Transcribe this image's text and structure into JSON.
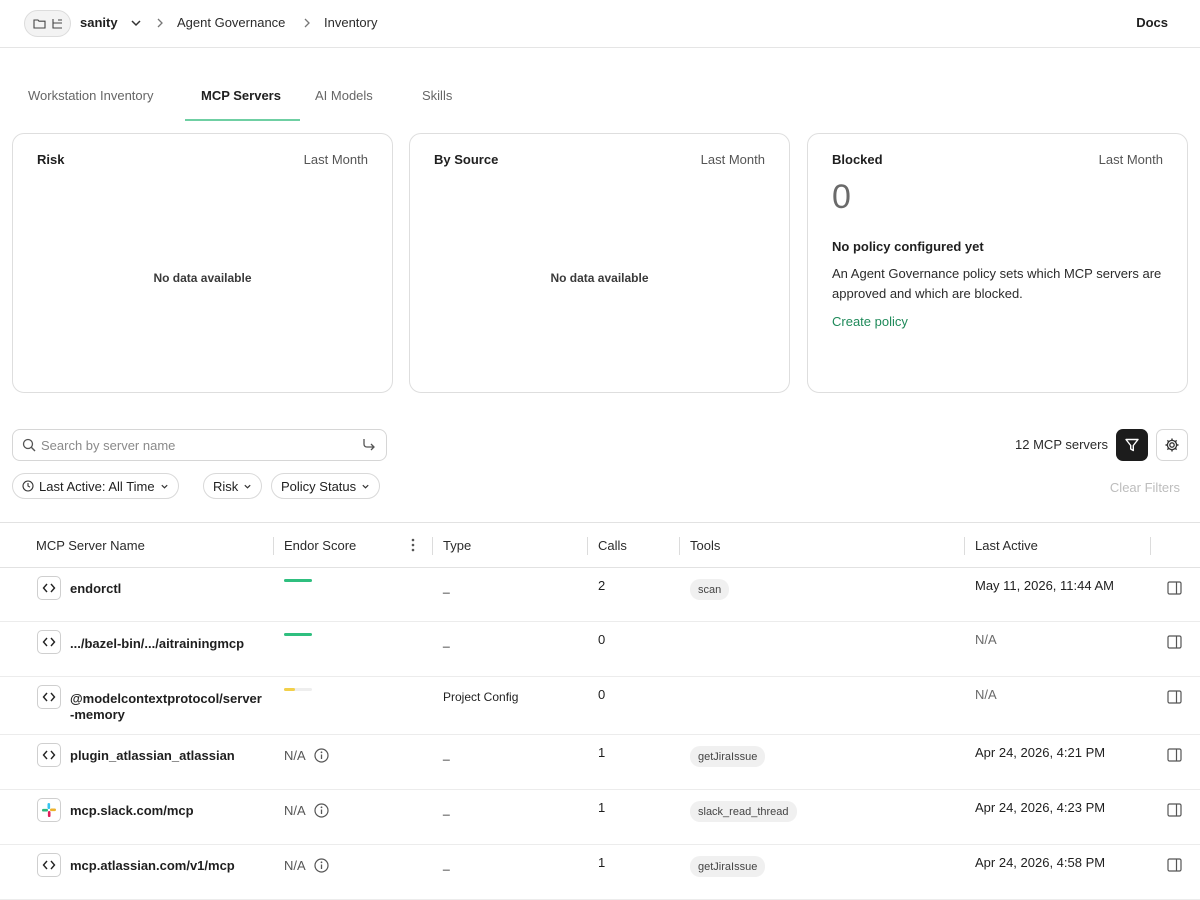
{
  "header": {
    "workspace": "sanity",
    "breadcrumbs": [
      "Agent Governance",
      "Inventory"
    ],
    "docs_label": "Docs"
  },
  "tabs": [
    {
      "label": "Workstation Inventory",
      "active": false
    },
    {
      "label": "MCP Servers",
      "active": true
    },
    {
      "label": "AI Models",
      "active": false
    },
    {
      "label": "Skills",
      "active": false
    }
  ],
  "cards": {
    "risk": {
      "title": "Risk",
      "range": "Last Month",
      "empty": "No data available"
    },
    "source": {
      "title": "By Source",
      "range": "Last Month",
      "empty": "No data available"
    },
    "blocked": {
      "title": "Blocked",
      "range": "Last Month",
      "count": "0",
      "heading": "No policy configured yet",
      "description": "An Agent Governance policy sets which MCP servers are approved and which are blocked.",
      "link": "Create policy"
    }
  },
  "search": {
    "placeholder": "Search by server name",
    "value": ""
  },
  "server_count": "12 MCP servers",
  "filters": [
    {
      "label": "Last Active: All Time"
    },
    {
      "label": "Risk"
    },
    {
      "label": "Policy Status"
    }
  ],
  "clear_filters": "Clear Filters",
  "table": {
    "columns": [
      "MCP Server Name",
      "Endor Score",
      "Type",
      "Calls",
      "Tools",
      "Last Active"
    ],
    "rows": [
      {
        "name": "endorctl",
        "icon": "code-icon",
        "score": "bar",
        "score_color": "#2fbf7f",
        "score_fill": 1.0,
        "type": "_",
        "calls": "2",
        "tools": "scan",
        "last_active": "May 11, 2026, 11:44 AM"
      },
      {
        "name": ".../bazel-bin/.../aitrainingmcp",
        "icon": "code-icon",
        "score": "bar",
        "score_color": "#2fbf7f",
        "score_fill": 1.0,
        "type": "_",
        "calls": "0",
        "tools": "",
        "last_active": "N/A"
      },
      {
        "name": "@modelcontextprotocol/server-memory",
        "icon": "code-icon",
        "score": "bar",
        "score_color": "#f2d04a",
        "score_fill": 0.4,
        "type": "Project Config",
        "calls": "0",
        "tools": "",
        "last_active": "N/A"
      },
      {
        "name": "plugin_atlassian_atlassian",
        "icon": "code-icon",
        "score": "N/A",
        "type": "_",
        "calls": "1",
        "tools": "getJiraIssue",
        "last_active": "Apr 24, 2026, 4:21 PM"
      },
      {
        "name": "mcp.slack.com/mcp",
        "icon": "slack-icon",
        "score": "N/A",
        "type": "_",
        "calls": "1",
        "tools": "slack_read_thread",
        "last_active": "Apr 24, 2026, 4:23 PM"
      },
      {
        "name": "mcp.atlassian.com/v1/mcp",
        "icon": "code-icon",
        "score": "N/A",
        "type": "_",
        "calls": "1",
        "tools": "getJiraIssue",
        "last_active": "Apr 24, 2026, 4:58 PM"
      }
    ]
  }
}
